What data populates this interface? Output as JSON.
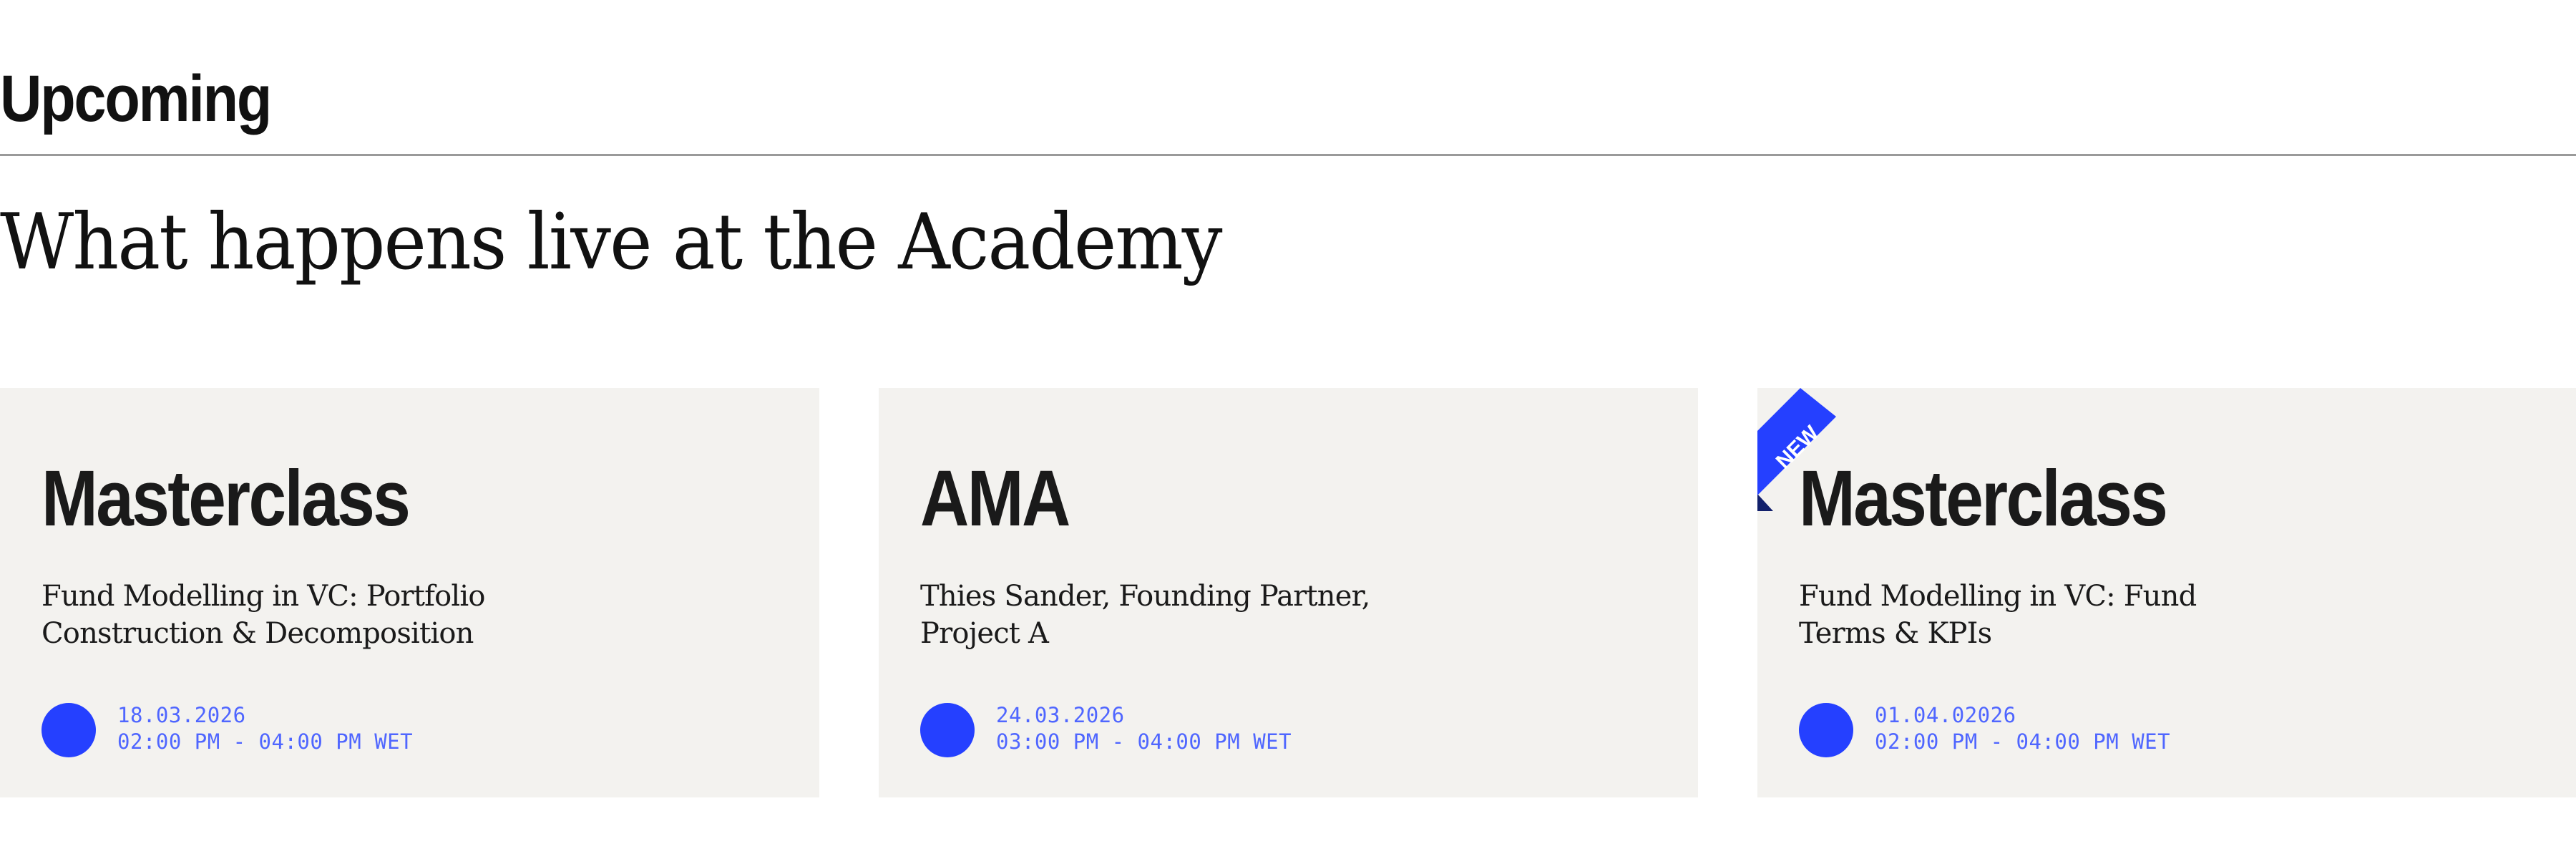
{
  "section": {
    "label": "Upcoming"
  },
  "headline": "What happens live at the Academy",
  "accent_color": "#2540ff",
  "cards": [
    {
      "type": "Masterclass",
      "description": "Fund Modelling in VC: Portfolio Construction & Decomposition",
      "date": "18.03.2026",
      "time": "02:00 PM - 04:00 PM WET",
      "badge": ""
    },
    {
      "type": "AMA",
      "description": "Thies Sander, Founding Partner, Project A",
      "date": "24.03.2026",
      "time": "03:00 PM - 04:00 PM WET",
      "badge": ""
    },
    {
      "type": "Masterclass",
      "description": "Fund Modelling in VC: Fund Terms & KPIs",
      "date": "01.04.02026",
      "time": "02:00 PM - 04:00 PM WET",
      "badge": "NEW"
    }
  ]
}
